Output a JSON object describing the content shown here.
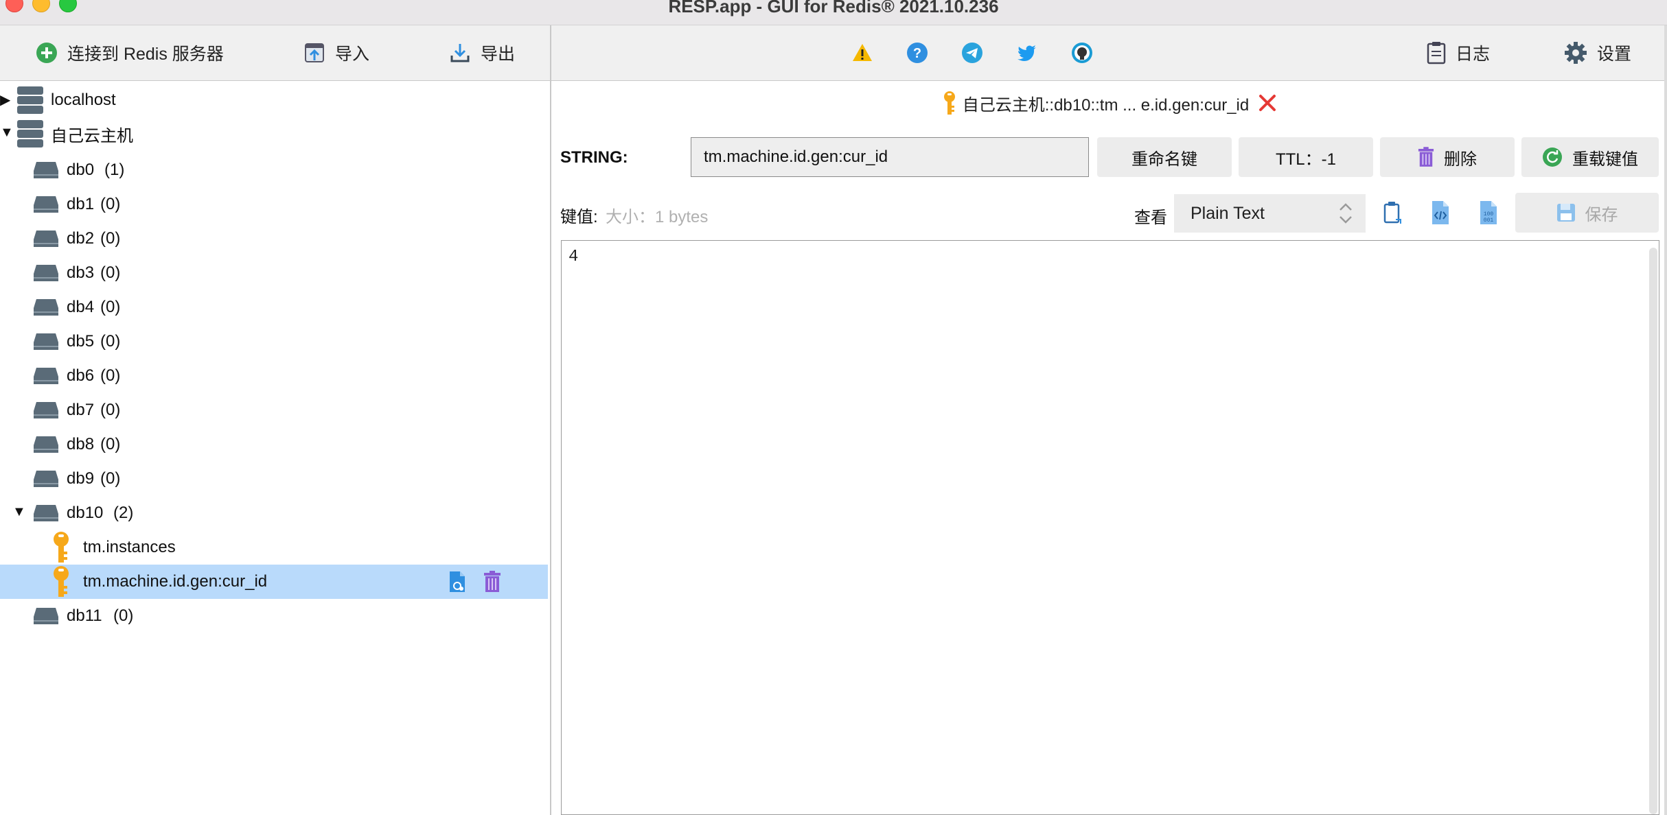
{
  "window": {
    "title": "RESP.app - GUI for Redis® 2021.10.236"
  },
  "toolbar": {
    "connect_label": "连接到 Redis 服务器",
    "import_label": "导入",
    "export_label": "导出",
    "log_label": "日志",
    "settings_label": "设置",
    "social_icons": [
      "warning-icon",
      "help-icon",
      "telegram-icon",
      "twitter-icon",
      "github-icon"
    ]
  },
  "tree": {
    "servers": [
      {
        "name": "localhost",
        "expanded": false
      },
      {
        "name": "自己云主机",
        "expanded": true
      }
    ],
    "databases": [
      {
        "name": "db0",
        "count": "(1)"
      },
      {
        "name": "db1",
        "count": "(0)"
      },
      {
        "name": "db2",
        "count": "(0)"
      },
      {
        "name": "db3",
        "count": "(0)"
      },
      {
        "name": "db4",
        "count": "(0)"
      },
      {
        "name": "db5",
        "count": "(0)"
      },
      {
        "name": "db6",
        "count": "(0)"
      },
      {
        "name": "db7",
        "count": "(0)"
      },
      {
        "name": "db8",
        "count": "(0)"
      },
      {
        "name": "db9",
        "count": "(0)"
      },
      {
        "name": "db10",
        "count": "(2)"
      },
      {
        "name": "db11",
        "count": "(0)"
      }
    ],
    "keys": [
      {
        "name": "tm.instances"
      },
      {
        "name": "tm.machine.id.gen:cur_id",
        "selected": true
      }
    ]
  },
  "tab": {
    "title": "自己云主机::db10::tm ... e.id.gen:cur_id"
  },
  "key_editor": {
    "type_label": "STRING:",
    "key_name": "tm.machine.id.gen:cur_id",
    "rename_label": "重命名键",
    "ttl_label": "TTL：-1",
    "delete_label": "删除",
    "reload_label": "重载键值",
    "value_label": "键值:",
    "size_label": "大小：1 bytes",
    "view_label": "查看",
    "format_selected": "Plain Text",
    "save_label": "保存",
    "value": "4"
  },
  "colors": {
    "selected_row": "#b9dafb",
    "key_icon": "#f6a81a",
    "delete_purple": "#8a5cd6",
    "close_red": "#e53935",
    "accent_blue": "#2f8fe0"
  }
}
